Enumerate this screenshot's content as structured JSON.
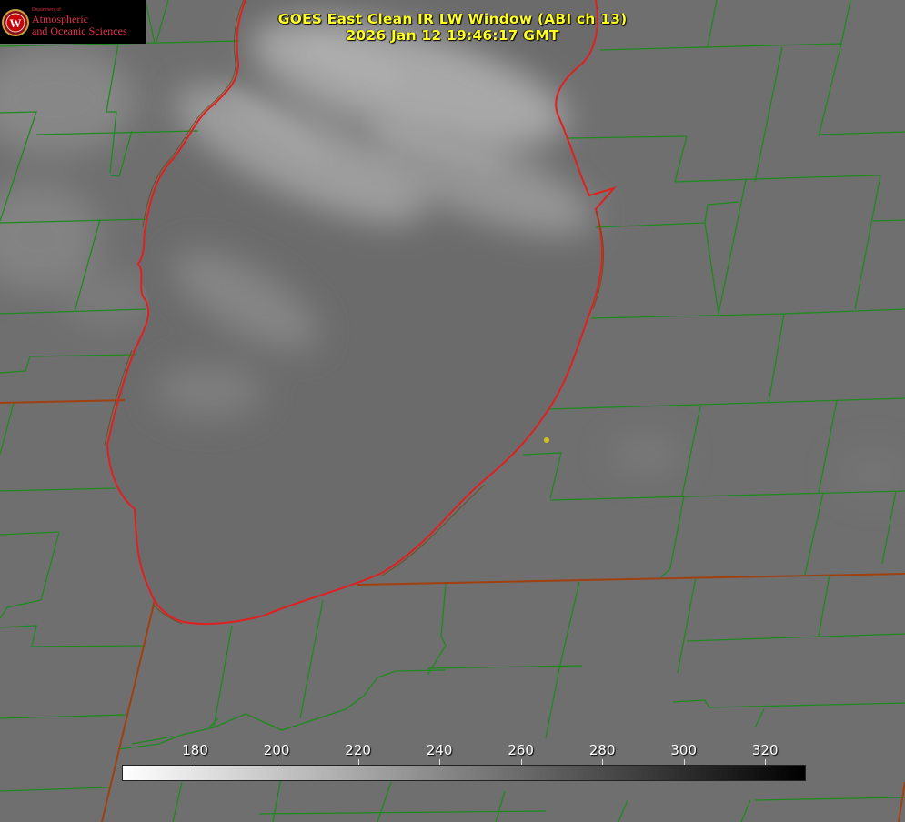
{
  "header": {
    "title_line_1": "GOES East Clean IR LW Window (ABI ch 13)",
    "title_line_2": "2026 Jan 12 19:46:17 GMT"
  },
  "logo": {
    "dept_label": "Department of",
    "line_1": "Atmospheric",
    "line_2": "and Oceanic Sciences",
    "letter": "W"
  },
  "colorbar": {
    "min": 162,
    "max": 330,
    "ticks": [
      "180",
      "200",
      "220",
      "240",
      "260",
      "280",
      "300",
      "320"
    ],
    "tick_values": [
      180,
      200,
      220,
      240,
      260,
      280,
      300,
      320
    ],
    "color_low": "#ffffff",
    "color_high": "#000000"
  },
  "map": {
    "background_color": "#6e6e6e",
    "county_line_color": "#1e8a1e",
    "state_line_color": "#a04010",
    "coast_line_color": "#e02020",
    "marker_color": "#d4c020",
    "icons": [
      "map-marker-icon"
    ]
  }
}
